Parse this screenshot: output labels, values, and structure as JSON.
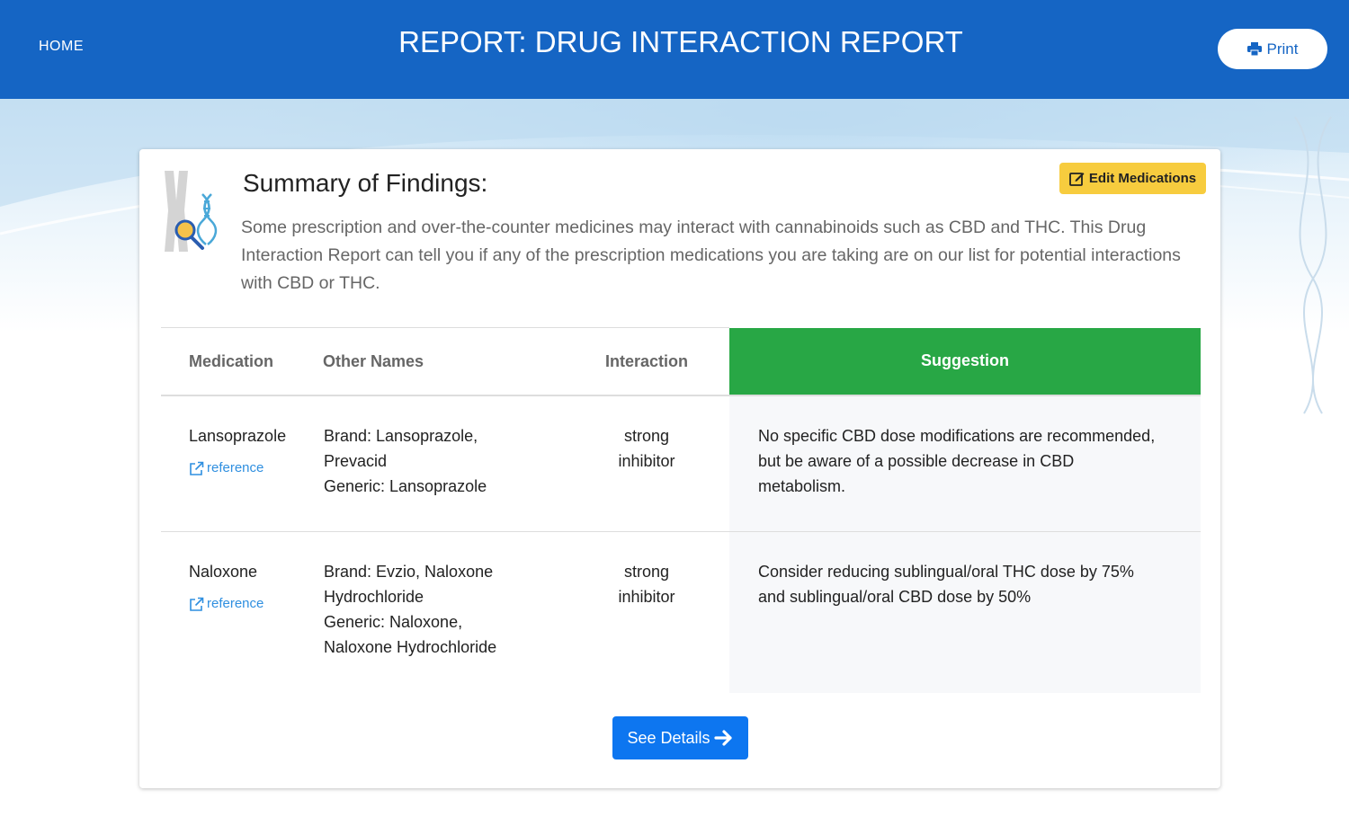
{
  "header": {
    "home_label": "HOME",
    "title": "REPORT: DRUG INTERACTION REPORT",
    "print_label": "Print"
  },
  "summary": {
    "title": "Summary of Findings:",
    "text": "Some prescription and over-the-counter medicines may interact with cannabinoids such as CBD and THC. This Drug Interaction Report can tell you if any of the prescription medications you are taking are on our list for potential interactions with CBD or THC.",
    "edit_label": "Edit Medications"
  },
  "table": {
    "headers": {
      "medication": "Medication",
      "other_names": "Other Names",
      "interaction": "Interaction",
      "suggestion": "Suggestion"
    },
    "rows": [
      {
        "medication": "Lansoprazole",
        "reference": "reference",
        "brand_1": "Brand: Lansoprazole,",
        "brand_2": "Prevacid",
        "generic_1": "Generic: Lansoprazole",
        "generic_2": "",
        "interaction_1": "strong",
        "interaction_2": "inhibitor",
        "suggestion": "No specific CBD dose modifications are recommended, but be aware of a possible decrease in CBD metabolism."
      },
      {
        "medication": "Naloxone",
        "reference": "reference",
        "brand_1": "Brand: Evzio, Naloxone",
        "brand_2": "Hydrochloride",
        "generic_1": "Generic: Naloxone,",
        "generic_2": "Naloxone Hydrochloride",
        "interaction_1": "strong",
        "interaction_2": "inhibitor",
        "suggestion": "Consider reducing sublingual/oral THC dose by 75% and sublingual/oral CBD dose by 50%"
      }
    ]
  },
  "details_label": "See Details",
  "colors": {
    "header": "#1565c4",
    "suggestion_header": "#28a745",
    "edit_button": "#f7cc3e",
    "details_button": "#0d76f0",
    "link": "#2f8fe0"
  },
  "icons": [
    "printer-icon",
    "dna-magnifier-icon",
    "edit-icon",
    "external-link-icon",
    "arrow-right-icon"
  ]
}
